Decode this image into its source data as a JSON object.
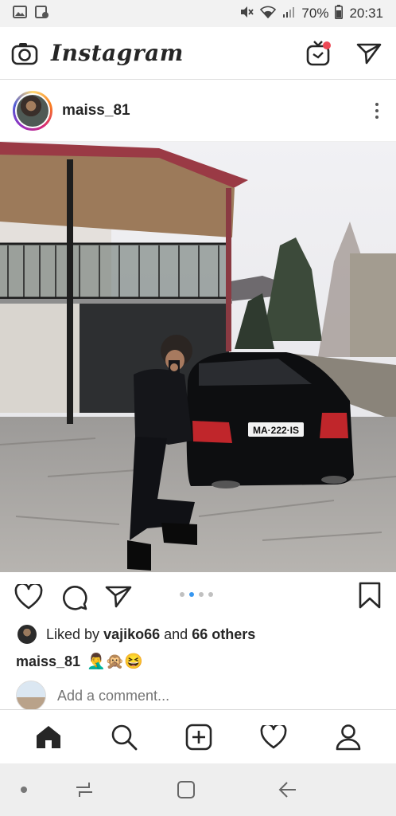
{
  "status": {
    "battery": "70%",
    "time": "20:31",
    "left_icons": [
      "gallery-icon",
      "screenshot-icon"
    ],
    "right_icons": [
      "mute-icon",
      "wifi-icon",
      "signal-icon",
      "battery-icon"
    ]
  },
  "header": {
    "app_name": "Instagram",
    "icons": [
      "camera-icon",
      "igtv-icon",
      "direct-message-icon"
    ],
    "igtv_badge_color": "#ed4956"
  },
  "post": {
    "username": "maiss_81",
    "image_description_icon": "photo",
    "carousel_pages": 4,
    "carousel_active_index": 1,
    "liked_by_prefix": "Liked by",
    "liked_by_user": "vajiko66",
    "liked_and": "and",
    "liked_others": "66 others",
    "caption_user": "maiss_81",
    "caption_emojis": "🤦‍♂️🙊😆"
  },
  "comment": {
    "placeholder": "Add a comment..."
  },
  "tabs": [
    "home-icon",
    "search-icon",
    "add-post-icon",
    "activity-icon",
    "profile-icon"
  ],
  "colors": {
    "accent": "#3897f0",
    "text": "#262626",
    "muted": "#999999"
  }
}
